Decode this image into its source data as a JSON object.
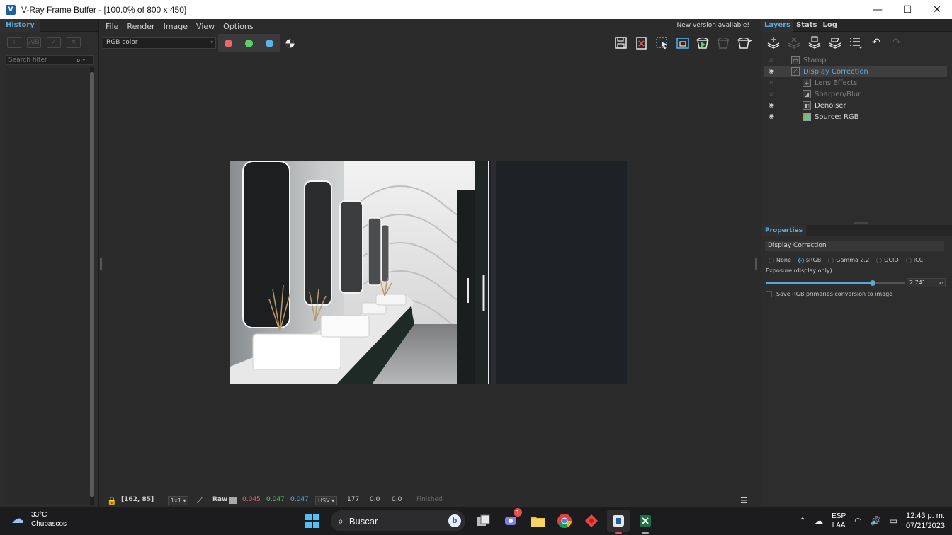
{
  "window": {
    "title": "V-Ray Frame Buffer - [100.0% of 800 x 450]",
    "minimize": "—",
    "maximize": "☐",
    "close": "✕"
  },
  "history": {
    "tab": "History",
    "search_placeholder": "Search filter"
  },
  "menu": {
    "items": [
      "File",
      "Render",
      "Image",
      "View",
      "Options"
    ],
    "new_version": "New version available!"
  },
  "toolbar": {
    "channel": "RGB color",
    "colors": {
      "red": "#e86b6b",
      "green": "#5ccf6a",
      "blue": "#5bb4ea"
    }
  },
  "layers_panel": {
    "tabs": [
      "Layers",
      "Stats",
      "Log"
    ],
    "layers": [
      {
        "name": "Stamp",
        "visible": false,
        "icon": "stamp-icon"
      },
      {
        "name": "Display Correction",
        "visible": true,
        "icon": "curve-icon",
        "selected": true
      },
      {
        "name": "Lens Effects",
        "visible": false,
        "icon": "plus-icon"
      },
      {
        "name": "Sharpen/Blur",
        "visible": false,
        "icon": "sharpen-icon"
      },
      {
        "name": "Denoiser",
        "visible": true,
        "icon": "denoiser-icon"
      },
      {
        "name": "Source: RGB",
        "visible": true,
        "icon": "source-icon"
      }
    ]
  },
  "properties": {
    "header": "Properties",
    "title": "Display Correction",
    "modes": [
      "None",
      "sRGB",
      "Gamma 2.2",
      "OCIO",
      "ICC"
    ],
    "selected_mode": "sRGB",
    "exposure_label": "Exposure (display only)",
    "exposure_value": "2.741",
    "exposure_fraction": 0.77,
    "checkbox_label": "Save RGB primaries conversion to image"
  },
  "status": {
    "coords": "[162, 85]",
    "ratio": "1x1",
    "raw": "Raw",
    "r": "0.045",
    "g": "0.047",
    "b": "0.047",
    "mode": "HSV",
    "h": "177",
    "s": "0.0",
    "v": "0.0",
    "state": "Finished"
  },
  "taskbar": {
    "temp": "33°C",
    "weather": "Chubascos",
    "search": "Buscar",
    "lang1": "ESP",
    "lang2": "LAA",
    "time": "12:43 p. m.",
    "date": "07/21/2023",
    "chat_badge": "1"
  }
}
